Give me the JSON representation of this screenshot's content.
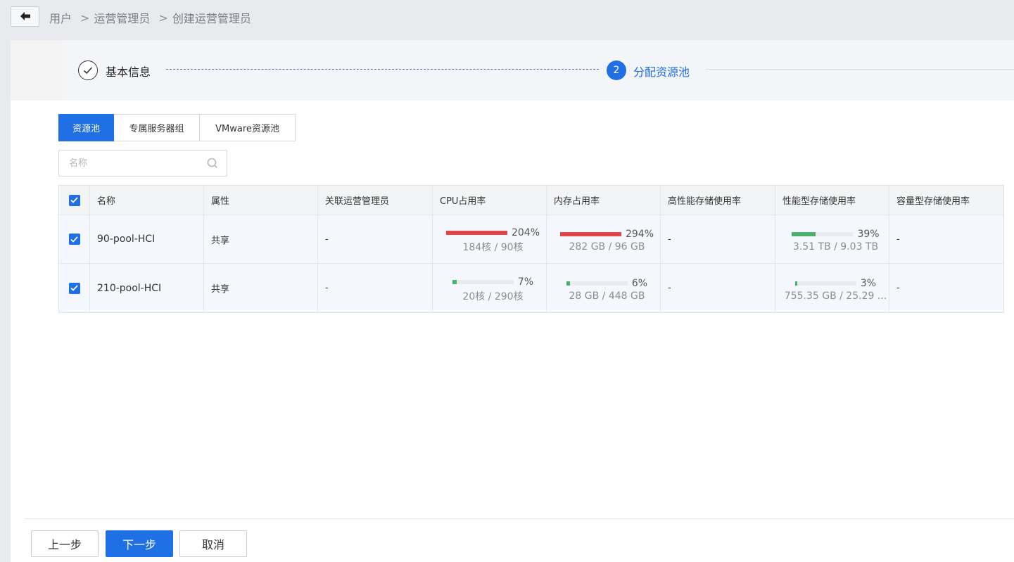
{
  "breadcrumb": {
    "items": [
      "用户",
      "运营管理员",
      "创建运营管理员"
    ],
    "separator": ">"
  },
  "steps": [
    {
      "label": "基本信息",
      "status": "completed",
      "icon": "check-icon"
    },
    {
      "label": "分配资源池",
      "status": "active",
      "number": "2"
    }
  ],
  "tabs": [
    {
      "label": "资源池",
      "active": true
    },
    {
      "label": "专属服务器组",
      "active": false
    },
    {
      "label": "VMware资源池",
      "active": false
    }
  ],
  "search": {
    "placeholder": "名称",
    "value": ""
  },
  "table": {
    "columns": [
      "名称",
      "属性",
      "关联运营管理员",
      "CPU占用率",
      "内存占用率",
      "高性能存储使用率",
      "性能型存储使用率",
      "容量型存储使用率"
    ],
    "header_checked": true,
    "rows": [
      {
        "checked": true,
        "name": "90-pool-HCI",
        "attr": "共享",
        "admin": "-",
        "cpu": {
          "pct": "204%",
          "level": 1.0,
          "status": "red",
          "detail": "184核 / 90核"
        },
        "mem": {
          "pct": "294%",
          "level": 1.0,
          "status": "red",
          "detail": "282 GB / 96 GB"
        },
        "hp_storage": "-",
        "perf_storage": {
          "pct": "39%",
          "level": 0.39,
          "status": "green",
          "detail": "3.51 TB / 9.03 TB"
        },
        "cap_storage": "-"
      },
      {
        "checked": true,
        "name": "210-pool-HCI",
        "attr": "共享",
        "admin": "-",
        "cpu": {
          "pct": "7%",
          "level": 0.07,
          "status": "green",
          "detail": "20核 / 290核"
        },
        "mem": {
          "pct": "6%",
          "level": 0.06,
          "status": "green",
          "detail": "28 GB / 448 GB"
        },
        "hp_storage": "-",
        "perf_storage": {
          "pct": "3%",
          "level": 0.03,
          "status": "green",
          "detail": "755.35 GB / 25.29 ..."
        },
        "cap_storage": "-"
      }
    ]
  },
  "footer": {
    "prev_label": "上一步",
    "next_label": "下一步",
    "cancel_label": "取消"
  },
  "colors": {
    "primary": "#1f6fe5",
    "danger": "#e04547",
    "success": "#4bb06b"
  }
}
